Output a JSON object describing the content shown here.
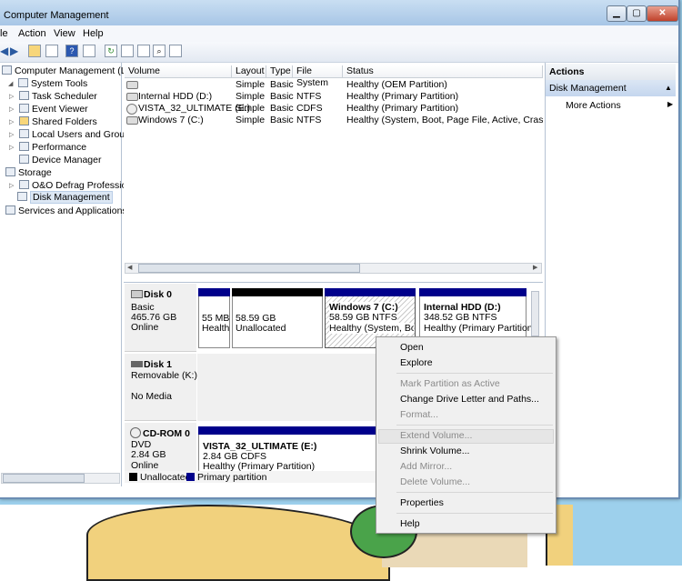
{
  "window": {
    "title": "Computer Management"
  },
  "menubar": [
    "le",
    "Action",
    "View",
    "Help"
  ],
  "tree": {
    "root": "Computer Management (Local",
    "system_tools": "System Tools",
    "items": [
      "Task Scheduler",
      "Event Viewer",
      "Shared Folders",
      "Local Users and Groups",
      "Performance",
      "Device Manager"
    ],
    "storage": "Storage",
    "storage_items": [
      "O&O Defrag Profession",
      "Disk Management"
    ],
    "services": "Services and Applications"
  },
  "volume_list": {
    "columns": [
      "Volume",
      "Layout",
      "Type",
      "File System",
      "Status"
    ],
    "rows": [
      {
        "volume": "",
        "layout": "Simple",
        "type": "Basic",
        "fs": "",
        "status": "Healthy (OEM Partition)"
      },
      {
        "volume": "Internal HDD (D:)",
        "layout": "Simple",
        "type": "Basic",
        "fs": "NTFS",
        "status": "Healthy (Primary Partition)"
      },
      {
        "volume": "VISTA_32_ULTIMATE (E:)",
        "layout": "Simple",
        "type": "Basic",
        "fs": "CDFS",
        "status": "Healthy (Primary Partition)"
      },
      {
        "volume": "Windows 7 (C:)",
        "layout": "Simple",
        "type": "Basic",
        "fs": "NTFS",
        "status": "Healthy (System, Boot, Page File, Active, Crash Dump"
      }
    ]
  },
  "disks": {
    "disk0": {
      "name": "Disk 0",
      "type": "Basic",
      "size": "465.76 GB",
      "state": "Online"
    },
    "disk1": {
      "name": "Disk 1",
      "type": "Removable (K:)",
      "state": "No Media"
    },
    "cdrom0": {
      "name": "CD-ROM 0",
      "type": "DVD",
      "size": "2.84 GB",
      "state": "Online"
    }
  },
  "partitions": {
    "p1": {
      "size": "55 MB",
      "status": "Healthy"
    },
    "p2": {
      "size": "58.59 GB",
      "status": "Unallocated"
    },
    "p3": {
      "name": "Windows 7  (C:)",
      "size": "58.59 GB NTFS",
      "status": "Healthy (System, Boot"
    },
    "p4": {
      "name": "Internal HDD  (D:)",
      "size": "348.52 GB NTFS",
      "status": "Healthy (Primary Partition)"
    },
    "cd": {
      "name": "VISTA_32_ULTIMATE  (E:)",
      "size": "2.84 GB CDFS",
      "status": "Healthy (Primary Partition)"
    }
  },
  "legend": {
    "unallocated": "Unallocated",
    "primary": "Primary partition"
  },
  "actions": {
    "header": "Actions",
    "section": "Disk Management",
    "more": "More Actions"
  },
  "context_menu": {
    "open": "Open",
    "explore": "Explore",
    "mark_active": "Mark Partition as Active",
    "change_letter": "Change Drive Letter and Paths...",
    "format": "Format...",
    "extend": "Extend Volume...",
    "shrink": "Shrink Volume...",
    "add_mirror": "Add Mirror...",
    "delete": "Delete Volume...",
    "properties": "Properties",
    "help": "Help"
  },
  "colors": {
    "primary": "#00008b",
    "unallocated": "#000000",
    "title_bar": "#b8d2ec"
  }
}
